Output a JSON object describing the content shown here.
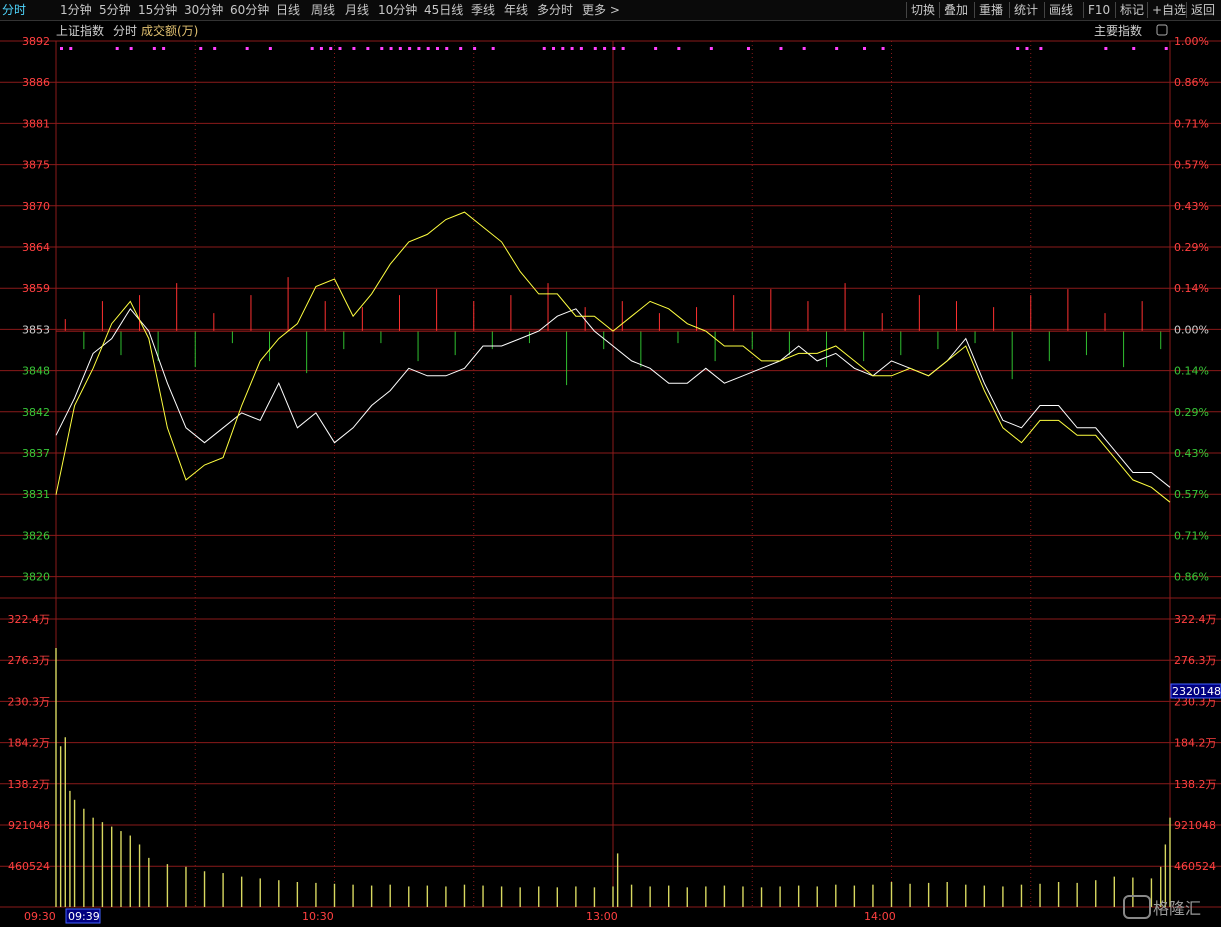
{
  "toolbar": {
    "periods": [
      "分时",
      "1分钟",
      "5分钟",
      "15分钟",
      "30分钟",
      "60分钟",
      "日线",
      "周线",
      "月线",
      "10分钟",
      "45日线",
      "季线",
      "年线",
      "多分时",
      "更多 >"
    ],
    "active": "分时",
    "tools": [
      "切换",
      "叠加",
      "重播",
      "统计",
      "画线",
      "F10",
      "标记",
      "+自选",
      "返回"
    ]
  },
  "legend": {
    "index_name": "上证指数",
    "mode": "分时",
    "volume_label": "成交额(万)",
    "indicator_button": "主要指数"
  },
  "crosshair": {
    "time_label": "09:39",
    "volume_label": "2320148"
  },
  "watermark": "格隆汇",
  "colors": {
    "background": "#000000",
    "grid": "#8a1a1a",
    "price_line": "#ffffff",
    "avg_line": "#ffff40",
    "up_bar": "#ff3030",
    "down_bar": "#30c030",
    "volume_bar": "#d8d860",
    "signal_dot": "#ff40ff"
  },
  "chart_data": [
    {
      "type": "line",
      "title": "上证指数 分时",
      "y_ticks_left": [
        "3892",
        "3886",
        "3881",
        "3875",
        "3870",
        "3864",
        "3859",
        "3853",
        "3848",
        "3842",
        "3837",
        "3831",
        "3826",
        "3820"
      ],
      "y_ticks_right": [
        "1.00%",
        "0.86%",
        "0.71%",
        "0.57%",
        "0.43%",
        "0.29%",
        "0.14%",
        "0.00%",
        "0.14%",
        "0.29%",
        "0.43%",
        "0.57%",
        "0.71%",
        "0.86%"
      ],
      "ylim": [
        3820,
        3892
      ],
      "prev_close": 3853,
      "x_ticks": [
        "09:30",
        "10:30",
        "13:00",
        "14:00"
      ],
      "series": [
        {
          "name": "价格",
          "x": [
            0,
            4,
            8,
            12,
            16,
            20,
            24,
            28,
            32,
            36,
            40,
            44,
            48,
            52,
            56,
            60,
            64,
            68,
            72,
            76,
            80,
            84,
            88,
            92,
            96,
            100,
            104,
            108,
            112,
            116,
            120,
            124,
            128,
            132,
            136,
            140,
            144,
            148,
            152,
            156,
            160,
            164,
            168,
            172,
            176,
            180,
            184,
            188,
            192,
            196,
            200,
            204,
            208,
            212,
            216,
            220,
            224,
            228,
            232,
            236,
            240
          ],
          "values": [
            3839,
            3844,
            3850,
            3852,
            3856,
            3853,
            3846,
            3840,
            3838,
            3840,
            3842,
            3841,
            3846,
            3840,
            3842,
            3838,
            3840,
            3843,
            3845,
            3848,
            3847,
            3847,
            3848,
            3851,
            3851,
            3852,
            3853,
            3855,
            3856,
            3853,
            3851,
            3849,
            3848,
            3846,
            3846,
            3848,
            3846,
            3847,
            3848,
            3849,
            3851,
            3849,
            3850,
            3848,
            3847,
            3849,
            3848,
            3847,
            3849,
            3852,
            3846,
            3841,
            3840,
            3843,
            3843,
            3840,
            3840,
            3837,
            3834,
            3834,
            3832
          ]
        },
        {
          "name": "均价",
          "x": [
            0,
            4,
            8,
            12,
            16,
            20,
            24,
            28,
            32,
            36,
            40,
            44,
            48,
            52,
            56,
            60,
            64,
            68,
            72,
            76,
            80,
            84,
            88,
            92,
            96,
            100,
            104,
            108,
            112,
            116,
            120,
            124,
            128,
            132,
            136,
            140,
            144,
            148,
            152,
            156,
            160,
            164,
            168,
            172,
            176,
            180,
            184,
            188,
            192,
            196,
            200,
            204,
            208,
            212,
            216,
            220,
            224,
            228,
            232,
            236,
            240
          ],
          "values": [
            3831,
            3843,
            3848,
            3854,
            3857,
            3852,
            3840,
            3833,
            3835,
            3836,
            3843,
            3849,
            3852,
            3854,
            3859,
            3860,
            3855,
            3858,
            3862,
            3865,
            3866,
            3868,
            3869,
            3867,
            3865,
            3861,
            3858,
            3858,
            3855,
            3855,
            3853,
            3855,
            3857,
            3856,
            3854,
            3853,
            3851,
            3851,
            3849,
            3849,
            3850,
            3850,
            3851,
            3849,
            3847,
            3847,
            3848,
            3847,
            3849,
            3851,
            3845,
            3840,
            3838,
            3841,
            3841,
            3839,
            3839,
            3836,
            3833,
            3832,
            3830
          ]
        }
      ]
    },
    {
      "type": "bar",
      "title": "成交额(万)",
      "y_ticks_left": [
        "322.4万",
        "276.3万",
        "230.3万",
        "184.2万",
        "138.2万",
        "921048",
        "460524"
      ],
      "y_ticks_right": [
        "322.4万",
        "276.3万",
        "230.3万",
        "184.2万",
        "138.2万",
        "921048",
        "460524"
      ],
      "ylim": [
        0,
        3224000
      ],
      "x_ticks": [
        "09:30",
        "10:30",
        "13:00",
        "14:00"
      ],
      "series": [
        {
          "name": "成交额",
          "x": [
            0,
            1,
            2,
            3,
            4,
            6,
            8,
            10,
            12,
            14,
            16,
            18,
            20,
            24,
            28,
            32,
            36,
            40,
            44,
            48,
            52,
            56,
            60,
            64,
            68,
            72,
            76,
            80,
            84,
            88,
            92,
            96,
            100,
            104,
            108,
            112,
            116,
            120,
            121,
            124,
            128,
            132,
            136,
            140,
            144,
            148,
            152,
            156,
            160,
            164,
            168,
            172,
            176,
            180,
            184,
            188,
            192,
            196,
            200,
            204,
            208,
            212,
            216,
            220,
            224,
            228,
            232,
            236,
            238,
            239,
            240
          ],
          "values": [
            2900000,
            1800000,
            1900000,
            1300000,
            1200000,
            1100000,
            1000000,
            950000,
            900000,
            850000,
            800000,
            700000,
            550000,
            480000,
            450000,
            400000,
            380000,
            340000,
            320000,
            300000,
            280000,
            270000,
            260000,
            250000,
            240000,
            250000,
            230000,
            240000,
            230000,
            250000,
            240000,
            230000,
            220000,
            230000,
            220000,
            230000,
            220000,
            230000,
            600000,
            250000,
            230000,
            240000,
            220000,
            230000,
            240000,
            230000,
            220000,
            230000,
            240000,
            230000,
            250000,
            240000,
            250000,
            280000,
            260000,
            270000,
            280000,
            250000,
            240000,
            230000,
            250000,
            260000,
            280000,
            270000,
            300000,
            340000,
            330000,
            320000,
            450000,
            700000,
            1000000
          ]
        }
      ]
    }
  ]
}
